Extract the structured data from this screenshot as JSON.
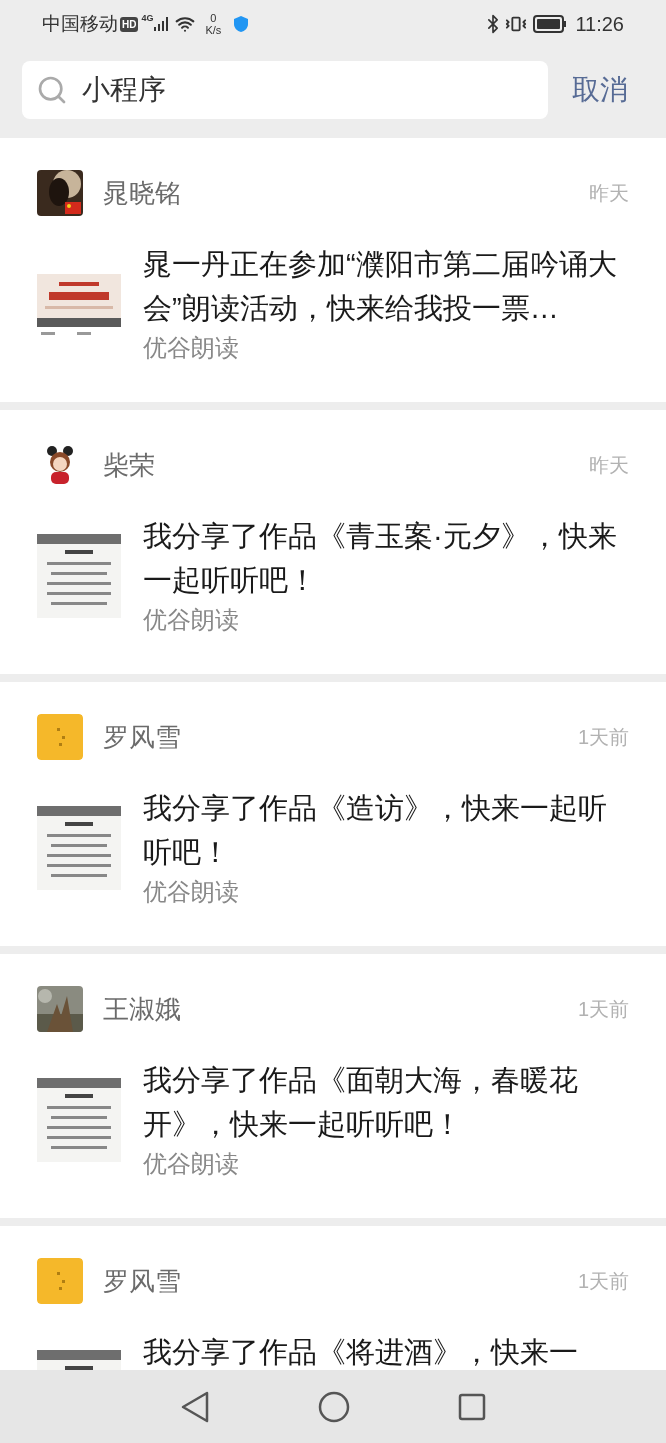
{
  "status_bar": {
    "carrier": "中国移动",
    "hd": "HD",
    "network": "4G",
    "speed_value": "0",
    "speed_unit": "K/s",
    "time": "11:26"
  },
  "search": {
    "value": "小程序",
    "cancel": "取消"
  },
  "results": [
    {
      "name": "晁晓铭",
      "time": "昨天",
      "title": "晁一丹正在参加“濮阳市第二届吟诵大会”朗读活动，快来给我投一票…",
      "source": "优谷朗读"
    },
    {
      "name": "柴荣",
      "time": "昨天",
      "title": "我分享了作品《青玉案·元夕》，快来一起听听吧！",
      "source": "优谷朗读"
    },
    {
      "name": "罗风雪",
      "time": "1天前",
      "title": "我分享了作品《造访》，快来一起听听吧！",
      "source": "优谷朗读"
    },
    {
      "name": "王淑娥",
      "time": "1天前",
      "title": "我分享了作品《面朝大海，春暖花开》，快来一起听听吧！",
      "source": "优谷朗读"
    },
    {
      "name": "罗风雪",
      "time": "1天前",
      "title": "我分享了作品《将进酒》，快来一"
    }
  ]
}
